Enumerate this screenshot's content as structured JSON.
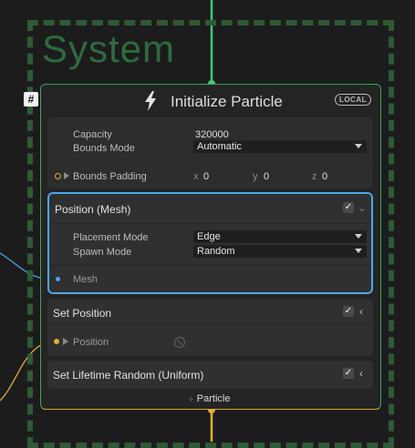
{
  "system": {
    "title": "System",
    "hash_label": "#"
  },
  "context": {
    "title": "Initialize Particle",
    "space_badge": "LOCAL",
    "icon": "lightning-bolt-icon",
    "output_label": "Particle",
    "output_icon": "particle-icon"
  },
  "properties": {
    "capacity_label": "Capacity",
    "capacity_value": "320000",
    "bounds_mode_label": "Bounds Mode",
    "bounds_mode_value": "Automatic",
    "bounds_padding_label": "Bounds Padding",
    "x_label": "x",
    "x_value": "0",
    "y_label": "y",
    "y_value": "0",
    "z_label": "z",
    "z_value": "0"
  },
  "blocks": {
    "position_mesh": {
      "title": "Position (Mesh)",
      "placement_mode_label": "Placement Mode",
      "placement_mode_value": "Edge",
      "spawn_mode_label": "Spawn Mode",
      "spawn_mode_value": "Random",
      "mesh_label": "Mesh",
      "enabled": true
    },
    "set_position": {
      "title": "Set Position",
      "position_label": "Position",
      "enabled": true
    },
    "set_lifetime": {
      "title": "Set Lifetime Random (Uniform)",
      "enabled": true
    }
  },
  "colors": {
    "flow_green": "#3ecb7a",
    "flow_yellow": "#e0b030",
    "selection_blue": "#4aa8e6",
    "system_dash": "#2e5a36"
  }
}
